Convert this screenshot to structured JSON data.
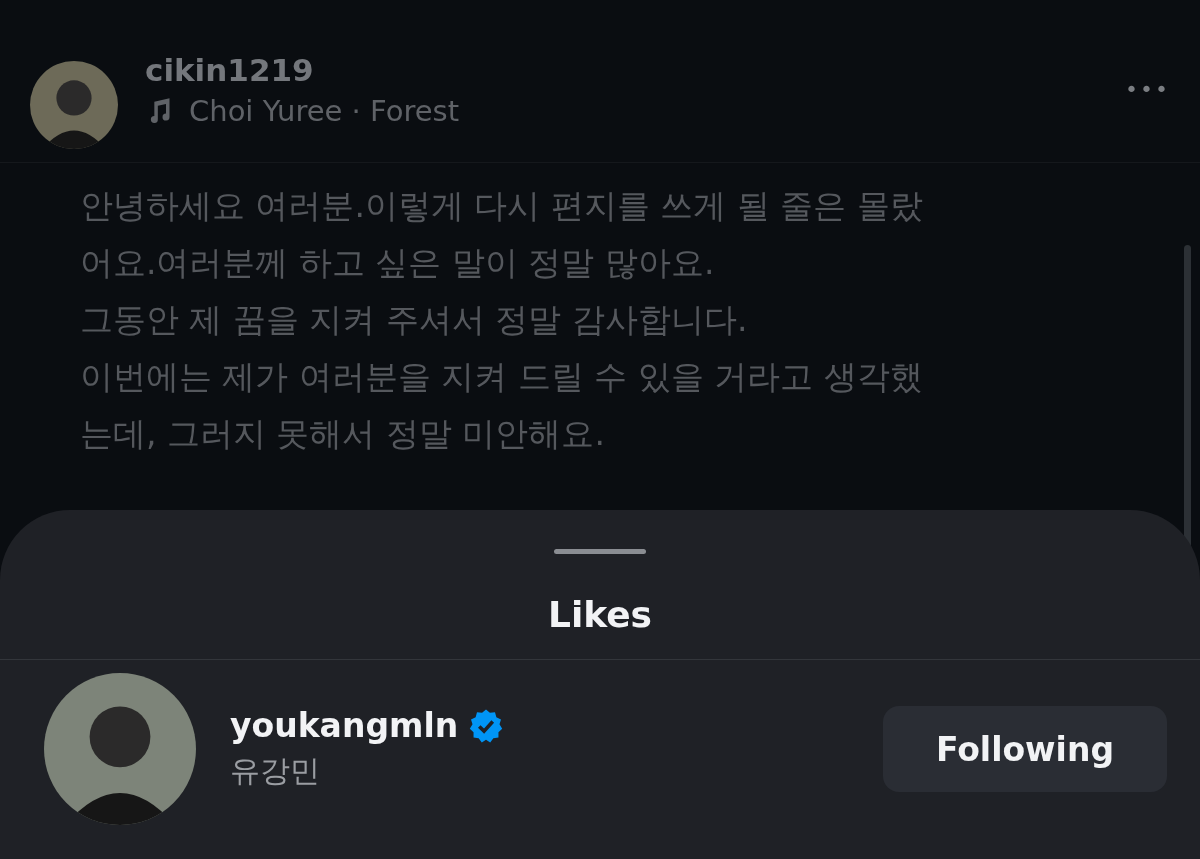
{
  "post": {
    "username": "cikin1219",
    "music": "Choi Yuree · Forest",
    "more": "•••",
    "lines": [
      "안녕하세요 여러분.이렇게 다시 편지를 쓰게 될 줄은 몰랐",
      "어요.여러분께 하고 싶은 말이 정말 많아요.",
      "그동안 제 꿈을 지켜 주셔서 정말 감사합니다.",
      "이번에는 제가 여러분을 지켜 드릴 수 있을 거라고 생각했",
      "는데, 그러지 못해서 정말 미안해요."
    ]
  },
  "sheet": {
    "title": "Likes",
    "users": [
      {
        "username": "youkangmln",
        "verified": true,
        "name": "유강민",
        "button": "Following"
      }
    ]
  }
}
